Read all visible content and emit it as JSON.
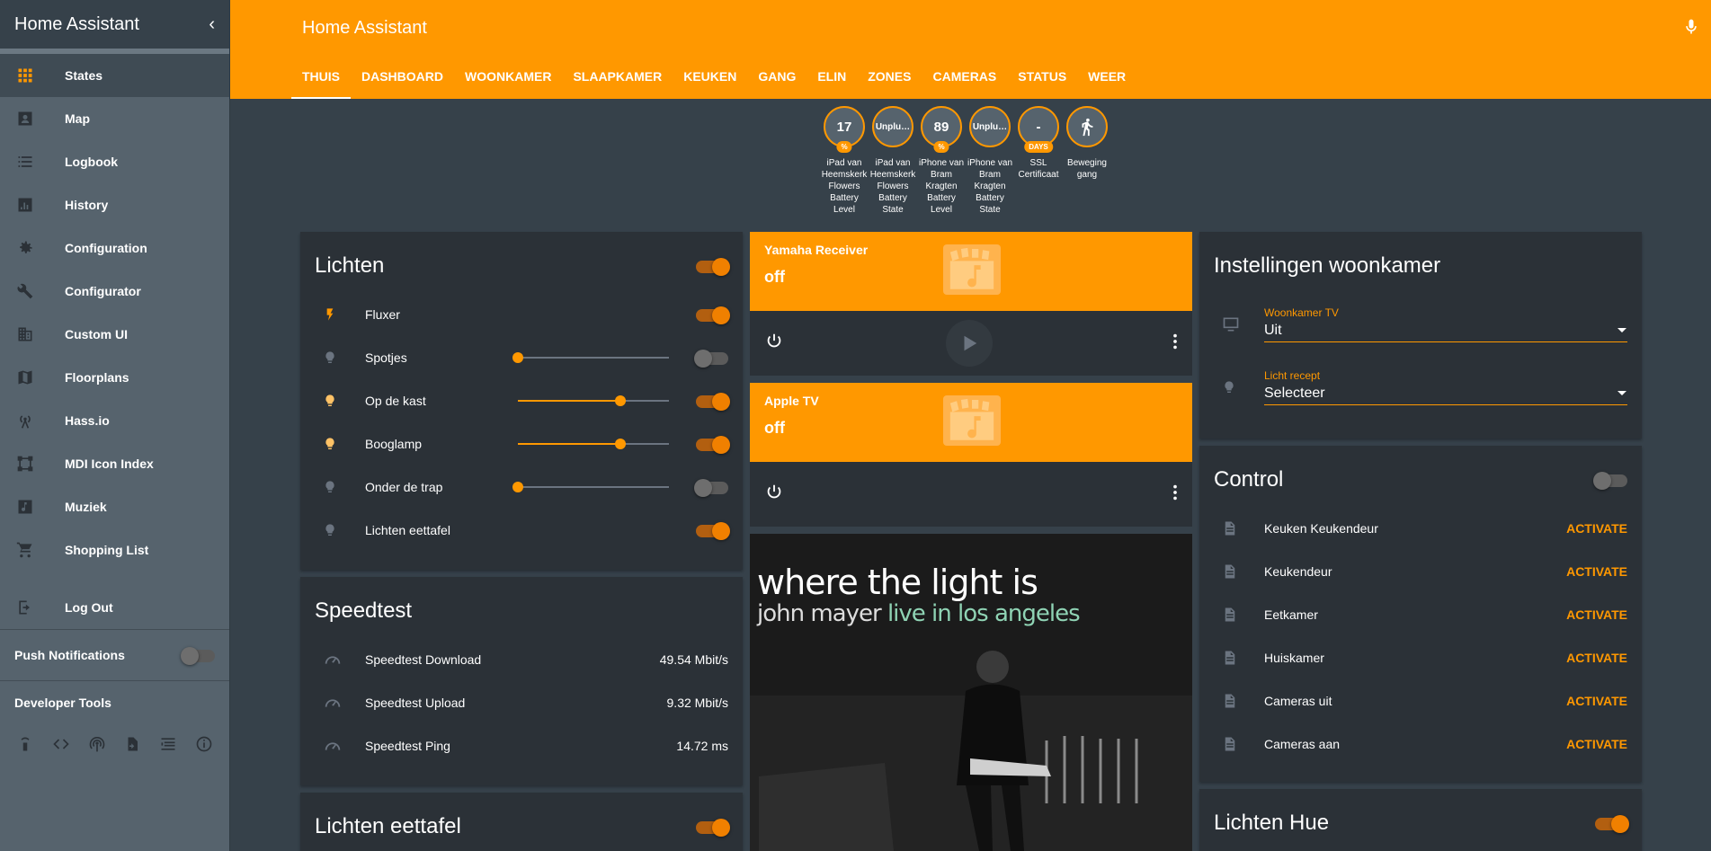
{
  "app": {
    "title": "Home Assistant"
  },
  "sidebar": {
    "items": [
      {
        "label": "States",
        "icon": "grid-icon"
      },
      {
        "label": "Map",
        "icon": "map-account-icon"
      },
      {
        "label": "Logbook",
        "icon": "list-icon"
      },
      {
        "label": "History",
        "icon": "chart-icon"
      },
      {
        "label": "Configuration",
        "icon": "gear-icon"
      },
      {
        "label": "Configurator",
        "icon": "wrench-icon"
      },
      {
        "label": "Custom UI",
        "icon": "building-icon"
      },
      {
        "label": "Floorplans",
        "icon": "map-icon"
      },
      {
        "label": "Hass.io",
        "icon": "antenna-icon"
      },
      {
        "label": "MDI Icon Index",
        "icon": "vector-icon"
      },
      {
        "label": "Muziek",
        "icon": "music-icon"
      },
      {
        "label": "Shopping List",
        "icon": "cart-icon"
      }
    ],
    "logout": "Log Out",
    "push": "Push Notifications",
    "push_on": false,
    "dev": "Developer Tools"
  },
  "header": {
    "title": "Home Assistant"
  },
  "tabs": [
    "THUIS",
    "DASHBOARD",
    "WOONKAMER",
    "SLAAPKAMER",
    "KEUKEN",
    "GANG",
    "ELIN",
    "ZONES",
    "CAMERAS",
    "STATUS",
    "WEER"
  ],
  "badges": [
    {
      "value": "17",
      "unit": "%",
      "label": "iPad van Heemskerk Flowers Battery Level"
    },
    {
      "value": "Unplu…",
      "unit": "",
      "label": "iPad van Heemskerk Flowers Battery State"
    },
    {
      "value": "89",
      "unit": "%",
      "label": "iPhone van Bram Kragten Battery Level"
    },
    {
      "value": "Unplu…",
      "unit": "",
      "label": "iPhone van Bram Kragten Battery State"
    },
    {
      "value": "-",
      "unit": "DAYS",
      "label": "SSL Certificaat"
    },
    {
      "value": "",
      "unit": "",
      "label": "Beweging gang"
    }
  ],
  "lichten": {
    "title": "Lichten",
    "on": true,
    "rows": [
      {
        "name": "Fluxer",
        "on": true,
        "brightness": null,
        "icon": "flash-icon",
        "lit": true
      },
      {
        "name": "Spotjes",
        "on": false,
        "brightness": 0,
        "icon": "bulb-icon",
        "lit": false
      },
      {
        "name": "Op de kast",
        "on": true,
        "brightness": 0.68,
        "icon": "bulb-icon",
        "lit": true
      },
      {
        "name": "Booglamp",
        "on": true,
        "brightness": 0.68,
        "icon": "bulb-icon",
        "lit": true
      },
      {
        "name": "Onder de trap",
        "on": false,
        "brightness": 0,
        "icon": "bulb-icon",
        "lit": false
      },
      {
        "name": "Lichten eettafel",
        "on": true,
        "brightness": null,
        "icon": "bulb-icon",
        "lit": false
      }
    ]
  },
  "speedtest": {
    "title": "Speedtest",
    "rows": [
      {
        "name": "Speedtest Download",
        "value": "49.54 Mbit/s"
      },
      {
        "name": "Speedtest Upload",
        "value": "9.32 Mbit/s"
      },
      {
        "name": "Speedtest Ping",
        "value": "14.72 ms"
      }
    ]
  },
  "eettafel": {
    "title": "Lichten eettafel",
    "on": true
  },
  "media": [
    {
      "name": "Yamaha Receiver",
      "state": "off"
    },
    {
      "name": "Apple TV",
      "state": "off"
    }
  ],
  "album": {
    "line1": "where the light is",
    "line2a": "john mayer",
    "line2b": "live in los angeles"
  },
  "instellingen": {
    "title": "Instellingen woonkamer",
    "selects": [
      {
        "label": "Woonkamer TV",
        "value": "Uit",
        "icon": "monitor-icon"
      },
      {
        "label": "Licht recept",
        "value": "Selecteer",
        "icon": "bulb-icon"
      }
    ]
  },
  "control": {
    "title": "Control",
    "on": false,
    "action": "ACTIVATE",
    "rows": [
      "Keuken Keukendeur",
      "Keukendeur",
      "Eetkamer",
      "Huiskamer",
      "Cameras uit",
      "Cameras aan"
    ]
  },
  "hue": {
    "title": "Lichten Hue",
    "on": true
  }
}
